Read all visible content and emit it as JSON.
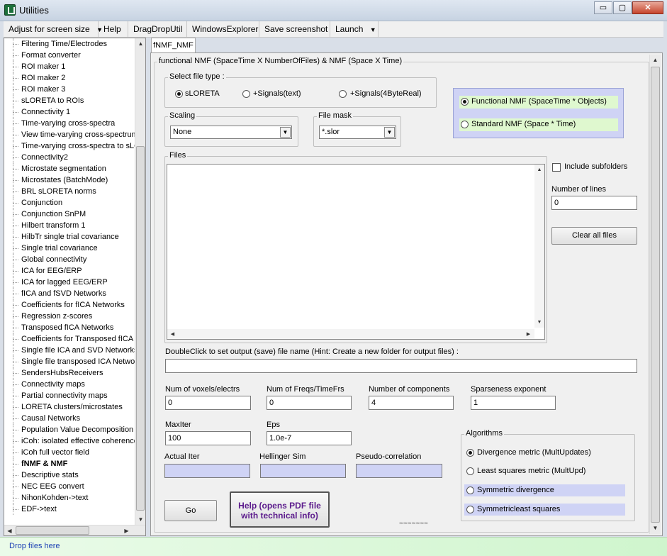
{
  "window": {
    "title": "Utilities",
    "minimize": "▭",
    "maximize": "▢",
    "close": "✕"
  },
  "menu": [
    {
      "label": "Adjust for screen size",
      "arrow": "▼"
    },
    {
      "label": "Help"
    },
    {
      "label": "DragDropUtil"
    },
    {
      "label": "WindowsExplorer"
    },
    {
      "label": "Save screenshot"
    },
    {
      "label": "Launch",
      "arrow": "▼"
    }
  ],
  "sidebar": {
    "items": [
      "Filtering Time/Electrodes",
      "Format converter",
      "ROI maker 1",
      "ROI maker 2",
      "ROI maker 3",
      "sLORETA to ROIs",
      "Connectivity 1",
      "Time-varying cross-spectra",
      "View time-varying cross-spectrum",
      "Time-varying cross-spectra to sLORETA",
      "Connectivity2",
      "Microstate segmentation",
      "Microstates (BatchMode)",
      "BRL sLORETA norms",
      "Conjunction",
      "Conjunction SnPM",
      "Hilbert transform 1",
      "HilbTr single trial covariance",
      "Single trial covariance",
      "Global connectivity",
      "ICA for EEG/ERP",
      "ICA for lagged EEG/ERP",
      "fICA and fSVD Networks",
      "Coefficients for fICA Networks",
      "Regression z-scores",
      "Transposed fICA Networks",
      "Coefficients for Transposed fICA",
      "Single file ICA and SVD Networks",
      "Single file transposed ICA Networks",
      "SendersHubsReceivers",
      "Connectivity maps",
      "Partial connectivity maps",
      "LORETA clusters/microstates",
      "Causal Networks",
      "Population Value Decomposition",
      "iCoh: isolated effective coherence",
      "iCoh full vector field",
      "fNMF & NMF",
      "Descriptive stats",
      "NEC EEG convert",
      "NihonKohden->text",
      "EDF->text"
    ],
    "selected_index": 37
  },
  "tab": {
    "label": "fNMF_NMF"
  },
  "main": {
    "frame_title": "functional NMF (SpaceTime X NumberOfFiles) & NMF (Space X Time)",
    "file_type": {
      "label": "Select file type :",
      "options": [
        "sLORETA",
        "+Signals(text)",
        "+Signals(4ByteReal)"
      ],
      "selected": 0
    },
    "nmf_type": {
      "options": [
        "Functional NMF  (SpaceTime * Objects)",
        "Standard NMF (Space * Time)"
      ],
      "selected": 0
    },
    "scaling": {
      "label": "Scaling",
      "value": "None"
    },
    "file_mask": {
      "label": "File mask",
      "value": "*.slor"
    },
    "files": {
      "label": "Files"
    },
    "include_subfolders": {
      "label": "Include subfolders",
      "checked": false
    },
    "number_of_lines": {
      "label": "Number of lines",
      "value": "0"
    },
    "clear_button": "Clear all files",
    "output_hint": "DoubleClick to set output (save) file name (Hint: Create a new folder for output files) :",
    "output_value": "",
    "num_voxels": {
      "label": "Num of voxels/electrs",
      "value": "0"
    },
    "num_freqs": {
      "label": "Num of Freqs/TimeFrs",
      "value": "0"
    },
    "num_components": {
      "label": "Number of components",
      "value": "4"
    },
    "sparseness": {
      "label": "Sparseness exponent",
      "value": "1"
    },
    "maxiter": {
      "label": "MaxIter",
      "value": "100"
    },
    "eps": {
      "label": "Eps",
      "value": "1.0e-7"
    },
    "actual_iter": {
      "label": "Actual Iter",
      "value": ""
    },
    "hellinger": {
      "label": "Hellinger Sim",
      "value": ""
    },
    "pseudo_corr": {
      "label": "Pseudo-correlation",
      "value": ""
    },
    "algorithms": {
      "label": "Algorithms",
      "options": [
        "Divergence metric (MultUpdates)",
        "Least squares metric (MultUpd)",
        "Symmetric divergence",
        "Symmetricleast squares"
      ],
      "selected": 0
    },
    "go_button": "Go",
    "help_button": {
      "line1": "Help (opens PDF file",
      "line2": "with technical info)"
    },
    "tilde": "~~~~~~~"
  },
  "status": {
    "drop_text": "Drop files here"
  },
  "colors": {
    "help_text": "#5b1a8c",
    "selected_bg": "#dff8cf",
    "highlight_blue": "#cfd3f5"
  }
}
